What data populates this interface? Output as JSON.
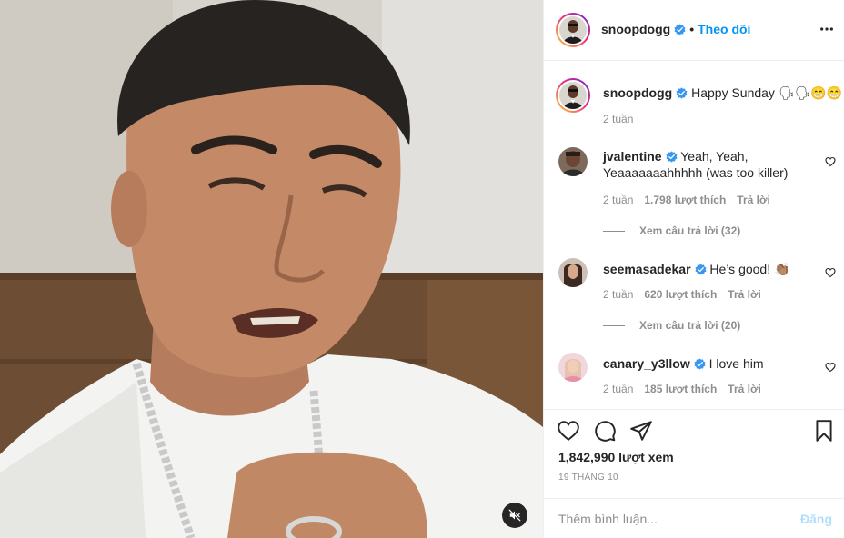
{
  "post": {
    "username": "snoopdogg",
    "verified": true,
    "follow_label": "Theo dõi",
    "more_icon": "more-horizontal-icon",
    "header_separator": "•"
  },
  "caption": {
    "username": "snoopdogg",
    "text": "Happy Sunday 🗣🗣😁😁",
    "time": "2 tuần"
  },
  "comments": [
    {
      "username": "jvalentine",
      "verified": true,
      "text": "Yeah, Yeah, Yeaaaaaaahhhhh (was too killer)",
      "time": "2 tuần",
      "likes": "1.798 lượt thích",
      "reply_label": "Trả lời",
      "view_replies": "Xem câu trả lời (32)"
    },
    {
      "username": "seemasadekar",
      "verified": true,
      "text": "He’s good! 👏🏽",
      "time": "2 tuần",
      "likes": "620 lượt thích",
      "reply_label": "Trả lời",
      "view_replies": "Xem câu trả lời (20)"
    },
    {
      "username": "canary_y3llow",
      "verified": true,
      "text": "I love him",
      "time": "2 tuần",
      "likes": "185 lượt thích",
      "reply_label": "Trả lời"
    }
  ],
  "actions": {
    "like_icon": "heart-icon",
    "comment_icon": "comment-icon",
    "share_icon": "paper-plane-icon",
    "save_icon": "bookmark-icon",
    "views": "1,842,990 lượt xem",
    "date": "19 THÁNG 10"
  },
  "add_comment": {
    "placeholder": "Thêm bình luận...",
    "post_label": "Đăng"
  },
  "media": {
    "type": "video",
    "mute_icon": "volume-muted-icon"
  },
  "colors": {
    "accent": "#0095f6",
    "verified": "#3897f0",
    "muted_text": "#8e8e8e",
    "border": "#efefef"
  }
}
